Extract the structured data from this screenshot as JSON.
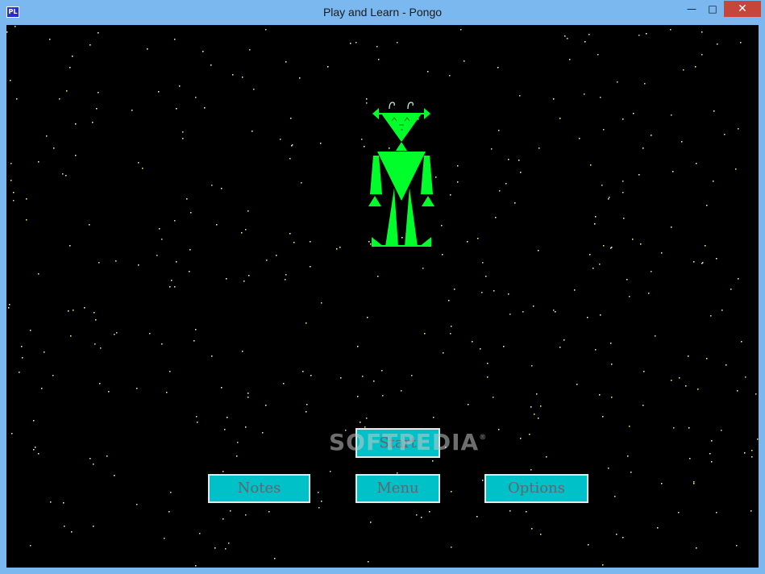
{
  "window": {
    "title": "Play and Learn - Pongo",
    "icon_text": "PL",
    "controls": {
      "minimize": "—",
      "maximize": "□",
      "close": "✕"
    }
  },
  "menu": {
    "start_label": "Start",
    "notes_label": "Notes",
    "menu_label": "Menu",
    "options_label": "Options"
  },
  "watermark": {
    "text": "SOFTPEDIA",
    "mark": "®"
  },
  "colors": {
    "robot": "#00ff2a",
    "button_bg": "#00c0c8",
    "button_text": "#5a6b6b",
    "space": "#000000"
  }
}
